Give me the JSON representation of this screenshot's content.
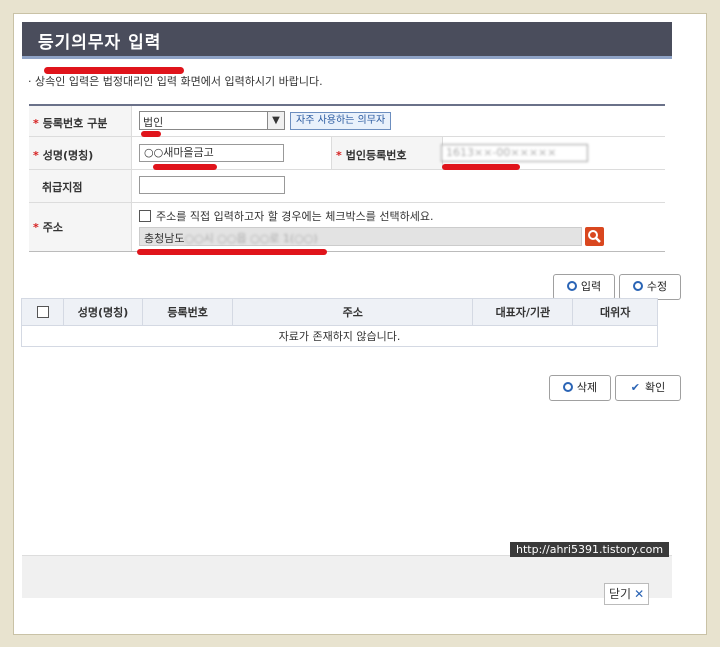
{
  "dialog": {
    "title": "등기의무자 입력",
    "notice": "· 상속인 입력은 법정대리인 입력 화면에서 입력하시기 바랍니다."
  },
  "form": {
    "reg_type_label": "등록번호 구분",
    "reg_type_value": "법인",
    "frequent_button": "자주 사용하는 의무자",
    "name_label": "성명(명칭)",
    "name_value": "○○새마을금고",
    "corp_reg_label": "법인등록번호",
    "corp_reg_value": "1613××-00×××××",
    "branch_label": "취급지점",
    "branch_value": "",
    "address_label": "주소",
    "address_checkbox_text": "주소를 직접 입력하고자 할 경우에는 체크박스를 선택하세요.",
    "address_prefix": "충청남도",
    "address_rest": "○○시 ○○읍 ○○로 1(○○)",
    "required_mark": "*"
  },
  "actions": {
    "input_button": "입력",
    "edit_button": "수정",
    "delete_button": "삭제",
    "confirm_button": "확인"
  },
  "table": {
    "headers": [
      "성명(명칭)",
      "등록번호",
      "주소",
      "대표자/기관",
      "대위자"
    ],
    "empty_message": "자료가 존재하지 않습니다."
  },
  "footer": {
    "watermark": "http://ahri5391.tistory.com",
    "close_label": "닫기"
  },
  "colors": {
    "title_bar": "#4a4d5c",
    "accent_blue": "#2a64b5",
    "required_red": "#d62020",
    "highlight_red": "#e0141b",
    "search_button": "#d9471f"
  }
}
